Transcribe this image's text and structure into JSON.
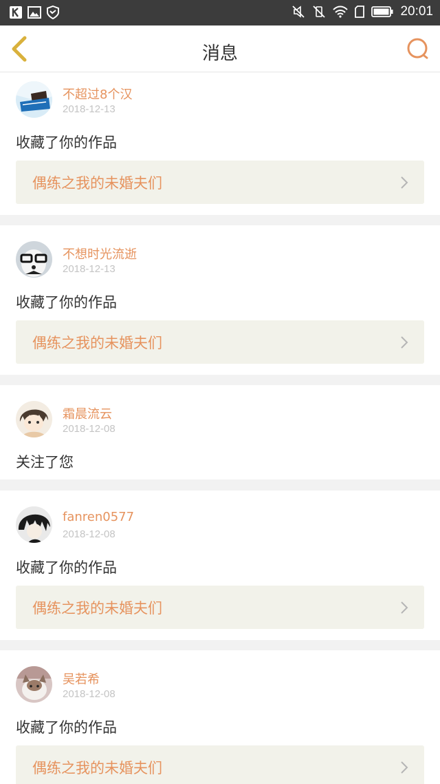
{
  "status_bar": {
    "time": "20:01",
    "left_icons": [
      "k-app-icon",
      "image-icon",
      "shield-icon"
    ],
    "right_icons": [
      "vibrate-off-icon",
      "silent-icon",
      "wifi-icon",
      "sim-icon",
      "battery-icon"
    ]
  },
  "header": {
    "title": "消息",
    "back_icon": "chevron-left-icon",
    "search_icon": "search-icon",
    "accent_color": "#e6935e",
    "back_color": "#d9b13c"
  },
  "messages": [
    {
      "user": "不超过8个汉",
      "date": "2018-12-13",
      "action": "收藏了你的作品",
      "work": "偶练之我的未婚夫们"
    },
    {
      "user": "不想时光流逝",
      "date": "2018-12-13",
      "action": "收藏了你的作品",
      "work": "偶练之我的未婚夫们"
    },
    {
      "user": "霜晨流云",
      "date": "2018-12-08",
      "action": "关注了您"
    },
    {
      "user": "fanren0577",
      "date": "2018-12-08",
      "action": "收藏了你的作品",
      "work": "偶练之我的未婚夫们"
    },
    {
      "user": "吴若希",
      "date": "2018-12-08",
      "action": "收藏了你的作品",
      "work": "偶练之我的未婚夫们"
    }
  ]
}
